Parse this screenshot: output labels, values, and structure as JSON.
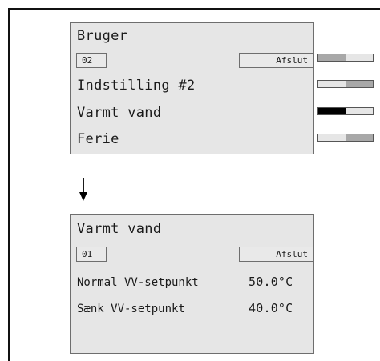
{
  "screen1": {
    "title": "Bruger",
    "field_value": "02",
    "exit_label": "Afslut",
    "menu": [
      "Indstilling #2",
      "Varmt vand",
      "Ferie"
    ]
  },
  "screen2": {
    "title": "Varmt vand",
    "field_value": "01",
    "exit_label": "Afslut",
    "rows": [
      {
        "label": "Normal VV-setpunkt",
        "value": "50.0°C"
      },
      {
        "label": "Sænk VV-setpunkt",
        "value": "40.0°C"
      }
    ]
  },
  "indicators": [
    {
      "segments": [
        "#a8a8a8",
        "#e6e6e6"
      ]
    },
    {
      "segments": [
        "#e6e6e6",
        "#a8a8a8"
      ]
    },
    {
      "segments": [
        "#000000",
        "#e6e6e6"
      ]
    },
    {
      "segments": [
        "#e6e6e6",
        "#a8a8a8"
      ]
    }
  ],
  "colors": {
    "panel": "#e6e6e6",
    "border": "#6e6e6e",
    "ink": "#1a1a1a"
  }
}
